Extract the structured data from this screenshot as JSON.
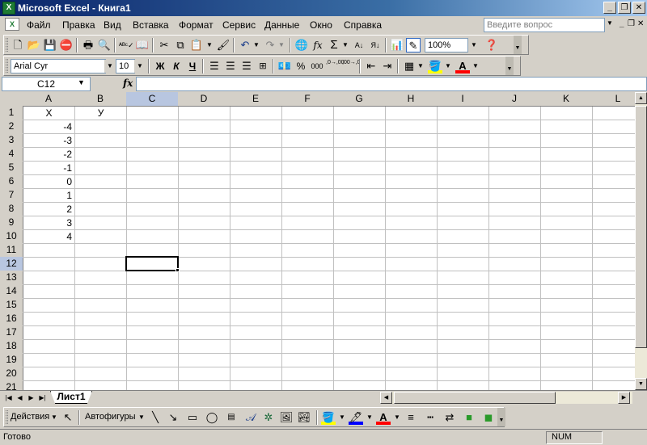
{
  "window": {
    "title": "Microsoft Excel - Книга1",
    "app_icon": "X",
    "minimize": "_",
    "maximize": "❐",
    "close": "✕"
  },
  "menu": {
    "items": [
      "Файл",
      "Правка",
      "Вид",
      "Вставка",
      "Формат",
      "Сервис",
      "Данные",
      "Окно",
      "Справка"
    ],
    "ask_placeholder": "Введите вопрос",
    "doc_minimize": "_",
    "doc_restore": "❐",
    "doc_close": "✕"
  },
  "standard_toolbar": {
    "zoom": "100%"
  },
  "format_toolbar": {
    "font_name": "Arial Cyr",
    "font_size": "10",
    "bold": "Ж",
    "italic": "К",
    "underline": "Ч",
    "percent": "%",
    "thousands": "000",
    "dec_inc": ",0→,00",
    "dec_dec": ",00→,0"
  },
  "formula_bar": {
    "name_box": "C12",
    "fx": "fx",
    "value": ""
  },
  "grid": {
    "columns": [
      "A",
      "B",
      "C",
      "D",
      "E",
      "F",
      "G",
      "H",
      "I",
      "J",
      "K",
      "L"
    ],
    "rows": [
      "1",
      "2",
      "3",
      "4",
      "5",
      "6",
      "7",
      "8",
      "9",
      "10",
      "11",
      "12",
      "13",
      "14",
      "15",
      "16",
      "17",
      "18",
      "19",
      "20",
      "21"
    ],
    "active_column": "C",
    "active_row": "12",
    "cells": {
      "A1": "X",
      "B1": "У",
      "A2": "-4",
      "A3": "-3",
      "A4": "-2",
      "A5": "-1",
      "A6": "0",
      "A7": "1",
      "A8": "2",
      "A9": "3",
      "A10": "4"
    }
  },
  "sheets": {
    "tabs": [
      "Лист1"
    ]
  },
  "draw_toolbar": {
    "actions": "Действия",
    "autoshapes": "Автофигуры"
  },
  "status": {
    "text": "Готово",
    "num": "NUM"
  }
}
